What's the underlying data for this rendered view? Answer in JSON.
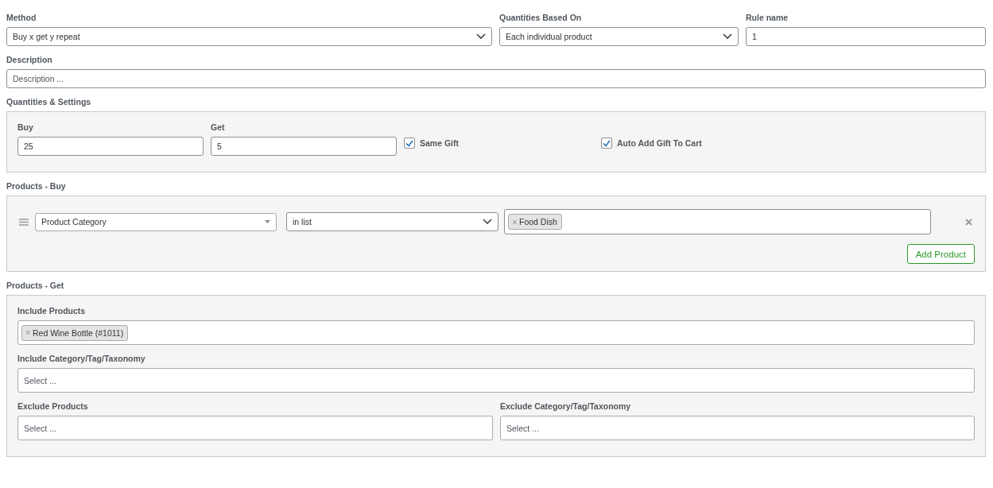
{
  "fields": [
    {
      "label": "Method",
      "value": "Buy x get y repeat",
      "kind": "select"
    },
    {
      "label": "Quantities Based On",
      "value": "Each individual product",
      "kind": "select"
    },
    {
      "label": "Rule name",
      "value": "1",
      "kind": "text"
    }
  ],
  "description": {
    "label": "Description",
    "placeholder": "Description ..."
  },
  "quantities": {
    "title": "Quantities & Settings",
    "buy": {
      "label": "Buy",
      "value": "25"
    },
    "get": {
      "label": "Get",
      "value": "5"
    },
    "options": [
      {
        "label": "Same Gift",
        "checked": true
      },
      {
        "label": "Auto Add Gift To Cart",
        "checked": true
      }
    ]
  },
  "products_buy": {
    "title": "Products - Buy",
    "conditions": [
      {
        "type": "Product Category",
        "operator": "in list",
        "tags": [
          "Food Dish"
        ]
      }
    ],
    "add_button": "Add Product"
  },
  "products_get": {
    "title": "Products - Get",
    "include_products": {
      "label": "Include Products",
      "tags": [
        "Red Wine Bottle (#1011)"
      ]
    },
    "include_taxonomy": {
      "label": "Include Category/Tag/Taxonomy",
      "placeholder": "Select ..."
    },
    "exclude_products": {
      "label": "Exclude Products",
      "placeholder": "Select ..."
    },
    "exclude_taxonomy": {
      "label": "Exclude Category/Tag/Taxonomy",
      "placeholder": "Select ..."
    }
  }
}
